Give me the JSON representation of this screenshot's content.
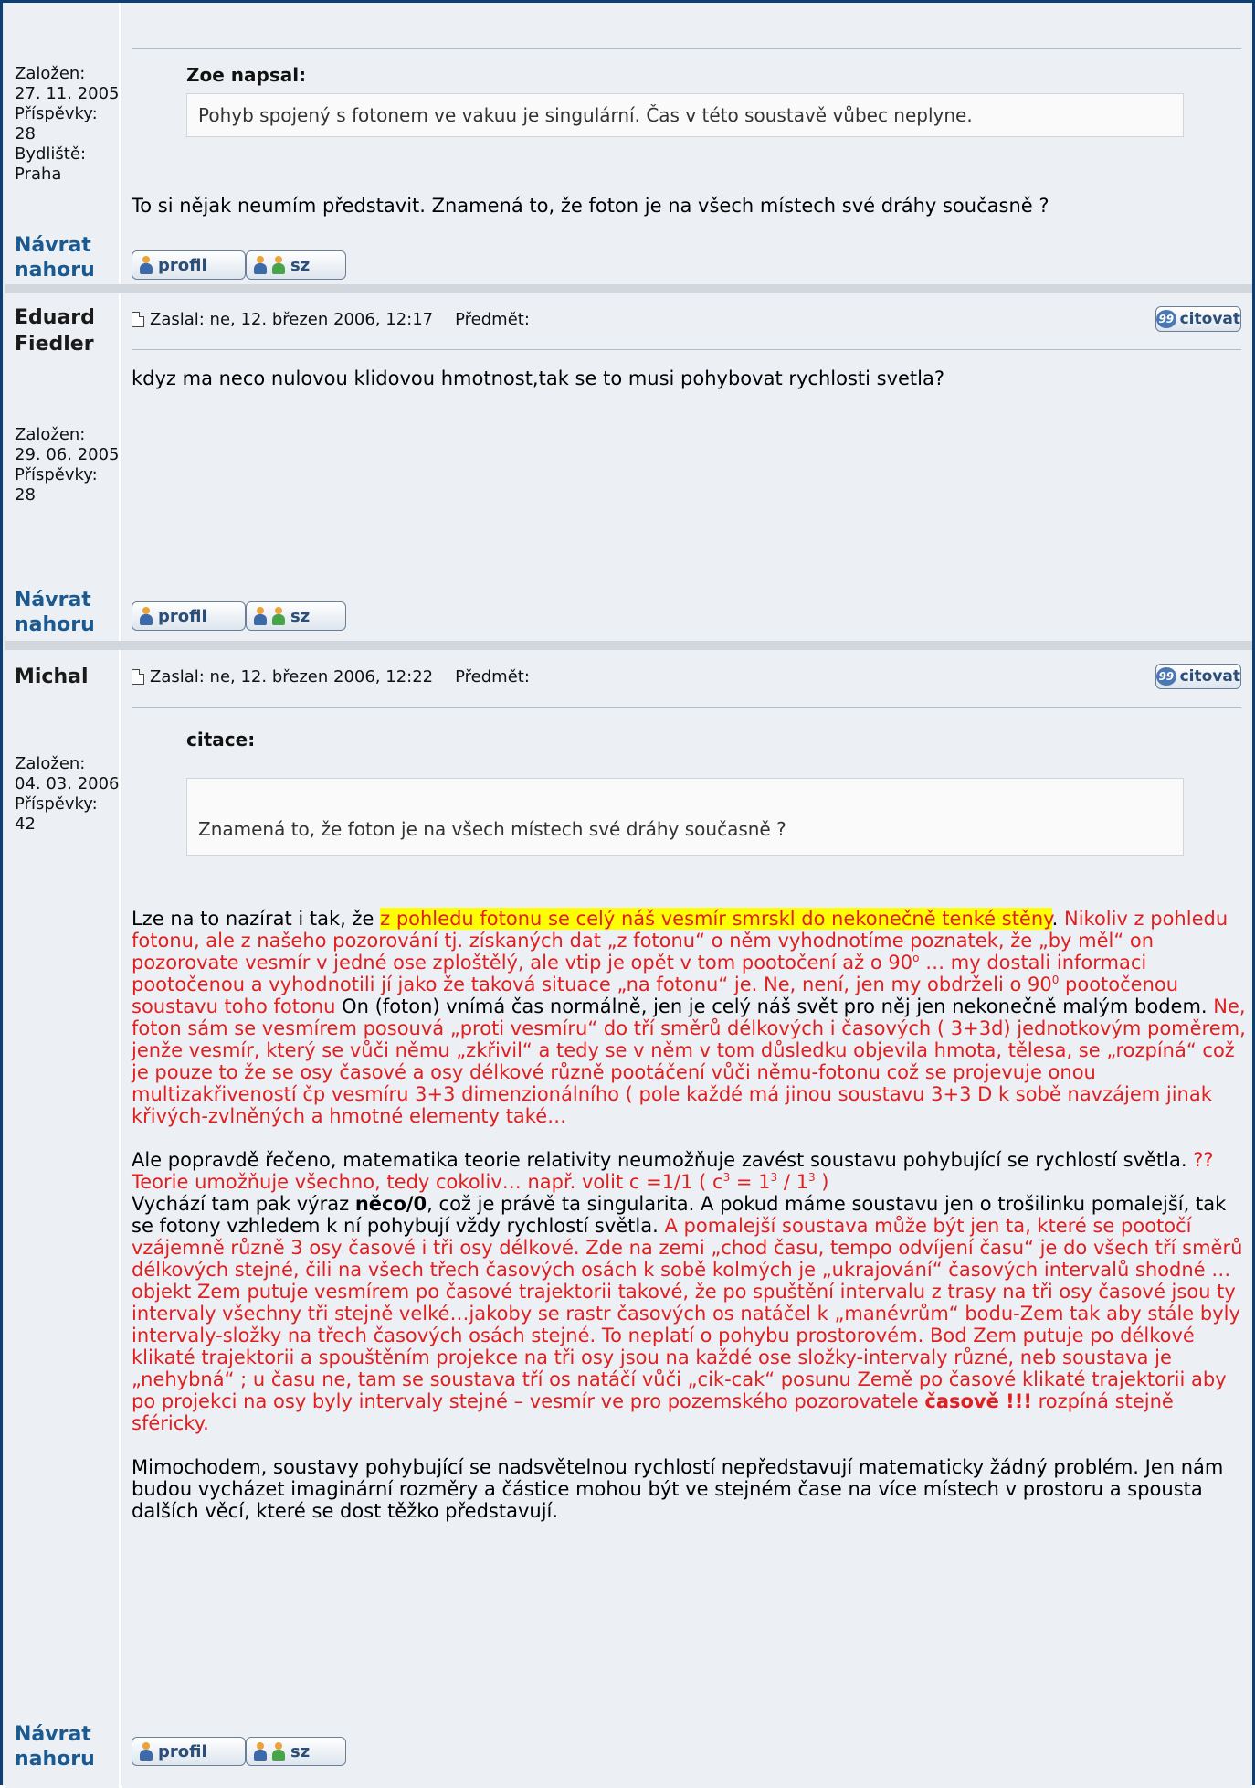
{
  "posts": [
    {
      "meta_label_joined": "Založen:",
      "meta_joined": "27. 11. 2005",
      "meta_label_posts": "Příspěvky:",
      "meta_posts": "28",
      "meta_label_city": "Bydliště:",
      "meta_city": "Praha",
      "quote_title": "Zoe napsal:",
      "quote_text": "Pohyb spojený s fotonem ve vakuu je singulární. Čas v této soustavě vůbec neplyne.",
      "text": "To si nějak neumím představit. Znamená to, že foton je na všech místech své dráhy současně ?"
    },
    {
      "author": "Eduard Fiedler",
      "author_line1": "Eduard",
      "author_line2": "Fiedler",
      "meta_label_joined": "Založen:",
      "meta_joined": "29. 06. 2005",
      "meta_label_posts": "Příspěvky:",
      "meta_posts": "28",
      "posted": "Zaslal: ne, 12. březen 2006, 12:17",
      "subject_label": "Předmět:",
      "text": "kdyz ma neco nulovou klidovou hmotnost,tak se to musi pohybovat rychlosti svetla?"
    },
    {
      "author": "Michal",
      "meta_label_joined": "Založen:",
      "meta_joined": "04. 03. 2006",
      "meta_label_posts": "Příspěvky:",
      "meta_posts": "42",
      "posted": "Zaslal: ne, 12. březen 2006, 12:22",
      "subject_label": "Předmět:",
      "quote_title": "citace:",
      "quote_text": "Znamená to, že foton je na všech místech své dráhy současně ?",
      "p1_a": "Lze na to nazírat i tak, že ",
      "p1_hl": "z pohledu fotonu se celý náš vesmír smrskl do nekonečně tenké stěny",
      "p1_b": ".",
      "p1_red": "Nikoliv z pohledu fotonu, ale z našeho pozorování tj. získaných dat „z fotonu“ o něm vyhodnotíme poznatek, že „by měl“ on pozorovate vesmír v jedné ose zploštělý, ale vtip je opět v tom pootočení až o 90",
      "p1_sup": "o",
      "p1_red2": " … my dostali informaci pootočenou a vyhodnotili jí jako že taková situace „na fotonu“ je. Ne, není, jen my obdrželi o 90",
      "p1_sup2": "0",
      "p1_red3": " pootočenou soustavu toho fotonu",
      "p1_c": " On (foton) vnímá čas normálně, jen je celý náš svět pro něj jen nekonečně malým bodem.",
      "p1_red4": " Ne, foton sám se vesmírem posouvá „proti vesmíru“ do tří směrů délkových i časových ( 3+3d) jednotkovým poměrem, jenže vesmír, který se vůči němu „zkřivil“ a tedy se v něm v tom důsledku objevila hmota, tělesa, se „rozpíná“ což je pouze to že se osy časové a osy délkové různě pootáčení vůči němu-fotonu což se projevuje onou multizakřiveností čp vesmíru 3+3 dimenzionálního ( pole každé má jinou soustavu 3+3 D k sobě navzájem jinak křivých-zvlněných a hmotné elementy také…",
      "p2_a": "Ale popravdě řečeno, matematika teorie relativity neumožňuje zavést soustavu pohybující se rychlostí světla.",
      "p2_red": " ?? Teorie umožňuje všechno, tedy cokoliv… např. volit c =1/1 ( c",
      "p2_sup1": "3",
      "p2_red_b": " = 1",
      "p2_sup2": "3",
      "p2_red_c": " / 1",
      "p2_sup3": "3",
      "p2_red_d": " )",
      "p2_b": "Vychází tam pak výraz ",
      "p2_bold": "něco/0",
      "p2_c": ", což je právě ta singularita. A pokud máme soustavu jen o trošilinku pomalejší, tak se fotony vzhledem k ní pohybují vždy rychlostí světla.",
      "p2_red2": " A pomalejší soustava může být jen ta, které se pootočí vzájemně různě 3 osy časové i tři osy délkové. Zde na zemi „chod času, tempo odvíjení času“ je do všech tří směrů délkových stejné, čili na všech třech časových osách k sobě kolmých je „ukrajování“ časových intervalů shodné … objekt Zem putuje vesmírem po časové trajektorii takové, že po spuštění intervalu z trasy na tři osy časové jsou ty intervaly všechny tři stejně velké…jakoby se rastr časových os natáčel k „manévrům“ bodu-Zem tak aby stále byly intervaly-složky na třech časových osách stejné. To neplatí o pohybu prostorovém. Bod Zem putuje po délkové klikaté trajektorii a spouštěním projekce na tři osy jsou na každé ose složky-intervaly různé, neb soustava je „nehybná“ ; u času ne, tam se soustava tří os natáčí vůči „cik-cak“ posunu Země po časové klikaté trajektorii aby po projekci na osy byly intervaly stejné – vesmír ve pro pozemského pozorovatele ",
      "p2_red_bold": "časově !!!",
      "p2_red3": " rozpíná stejně sféricky.",
      "p3": "Mimochodem, soustavy pohybující se nadsvětelnou rychlostí nepředstavují matematicky žádný problém. Jen nám budou vycházet imaginární rozměry a částice mohou být ve stejném čase na více místech v prostoru a spousta dalších věcí, které se dost těžko představují."
    }
  ],
  "back_line1": "Návrat",
  "back_line2": "nahoru",
  "profile_label": "profil",
  "pm_label": "sz",
  "cite_label": "citovat"
}
